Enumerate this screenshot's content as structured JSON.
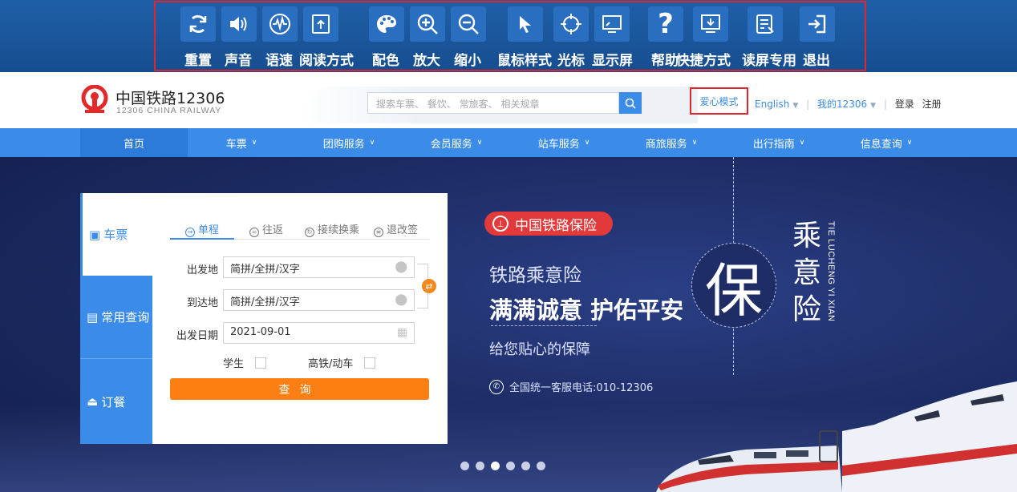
{
  "accessibility_toolbar": {
    "tools": [
      {
        "label": "重置",
        "icon": "reset-icon"
      },
      {
        "label": "声音",
        "icon": "sound-icon"
      },
      {
        "label": "语速",
        "icon": "speech-speed-icon"
      },
      {
        "label": "阅读方式",
        "icon": "reading-mode-icon"
      },
      {
        "label": "配色",
        "icon": "color-palette-icon"
      },
      {
        "label": "放大",
        "icon": "zoom-in-icon"
      },
      {
        "label": "缩小",
        "icon": "zoom-out-icon"
      },
      {
        "label": "鼠标样式",
        "icon": "mouse-pointer-icon"
      },
      {
        "label": "光标",
        "icon": "crosshair-icon"
      },
      {
        "label": "显示屏",
        "icon": "display-screen-icon"
      },
      {
        "label": "帮助",
        "icon": "help-icon"
      },
      {
        "label": "快捷方式",
        "icon": "shortcut-icon"
      },
      {
        "label": "读屏专用",
        "icon": "screen-reader-icon"
      },
      {
        "label": "退出",
        "icon": "exit-icon"
      }
    ]
  },
  "header": {
    "logo_cn": "中国铁路12306",
    "logo_en": "12306 CHINA RAILWAY",
    "search_placeholder": "搜索车票、 餐饮、 常旅客、 相关规章",
    "care_mode": "爱心模式",
    "language": "English",
    "my_account": "我的12306",
    "login": "登录",
    "register": "注册"
  },
  "nav": {
    "items": [
      {
        "label": "首页",
        "dropdown": false
      },
      {
        "label": "车票",
        "dropdown": true
      },
      {
        "label": "团购服务",
        "dropdown": true
      },
      {
        "label": "会员服务",
        "dropdown": true
      },
      {
        "label": "站车服务",
        "dropdown": true
      },
      {
        "label": "商旅服务",
        "dropdown": true
      },
      {
        "label": "出行指南",
        "dropdown": true
      },
      {
        "label": "信息查询",
        "dropdown": true
      }
    ]
  },
  "booking": {
    "side_tabs": [
      "车票",
      "常用查询",
      "订餐"
    ],
    "trip_tabs": [
      "单程",
      "往返",
      "接续换乘",
      "退改签"
    ],
    "from_label": "出发地",
    "from_value": "简拼/全拼/汉字",
    "to_label": "到达地",
    "to_value": "简拼/全拼/汉字",
    "date_label": "出发日期",
    "date_value": "2021-09-01",
    "student_label": "学生",
    "highspeed_label": "高铁/动车",
    "query_button": "查询"
  },
  "hero": {
    "badge": "中国铁路保险",
    "line1": "铁路乘意险",
    "line2": "满满诚意 护佑平安",
    "line3": "给您贴心的保障",
    "phone": "全国统一客服电话:010-12306",
    "big_char": "保",
    "vertical_text": "乘意险",
    "pinyin": "TIE LUCHENG YI XIAN",
    "carousel_count": 6,
    "carousel_active_index": 2
  },
  "colors": {
    "toolbar_bg": "#1f5fa8",
    "accent_blue": "#3b8ce8",
    "highlight_red": "#e3242b",
    "query_orange": "#fb7f12",
    "hero_dark": "#1d2d66"
  }
}
